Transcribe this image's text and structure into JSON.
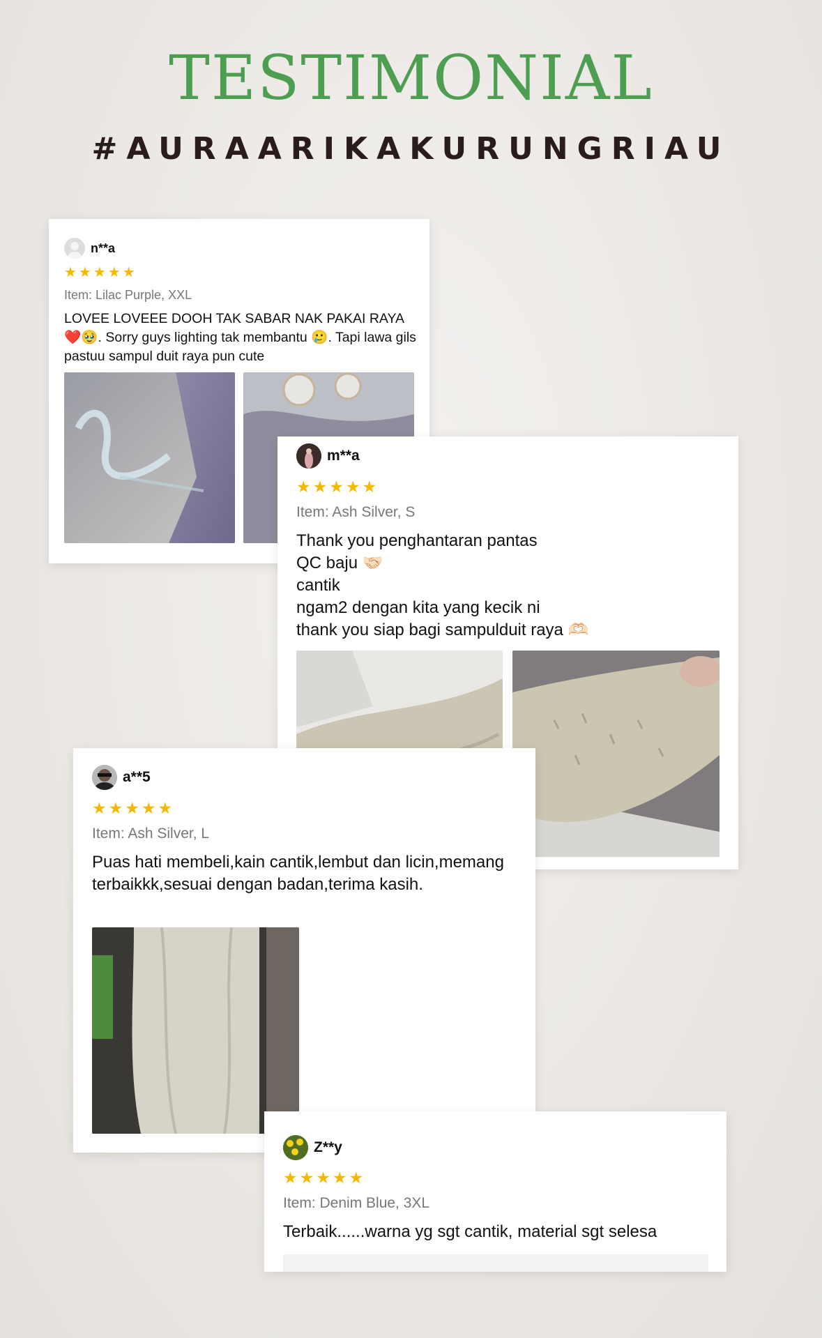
{
  "page": {
    "title": "TESTIMONIAL",
    "hashtag": "#AURAARIKAKURUNGRIAU"
  },
  "colors": {
    "title": "#4e9e52",
    "hashtag": "#2a1c1a",
    "stars": "#f5b800"
  },
  "reviews": [
    {
      "user": "n**a",
      "stars": "★★★★★",
      "rating": 5,
      "item": "Item: Lilac Purple, XXL",
      "text": "LOVEE LOVEEE DOOH TAK SABAR NAK PAKAI RAYA ❤️🥹. Sorry guys lighting tak membantu 🥲. Tapi lawa gils pastuu sampul duit raya pun cute",
      "avatar_icon": "default-user-icon"
    },
    {
      "user": "m**a",
      "stars": "★★★★★",
      "rating": 5,
      "item": "Item: Ash Silver, S",
      "text": "Thank you penghantaran pantas\nQC baju 🤝🏻\ncantik\nngam2 dengan kita yang kecik ni\nthank you siap bagi sampulduit raya 🫶🏻",
      "avatar_icon": "user-photo-icon"
    },
    {
      "user": "a**5",
      "stars": "★★★★★",
      "rating": 5,
      "item": "Item: Ash Silver, L",
      "text": "Puas hati membeli,kain cantik,lembut dan licin,memang terbaikkk,sesuai dengan badan,terima kasih.",
      "avatar_icon": "user-photo-icon"
    },
    {
      "user": "Z**y",
      "stars": "★★★★★",
      "rating": 5,
      "item": "Item: Denim Blue, 3XL",
      "text": "Terbaik......warna yg sgt cantik, material sgt selesa",
      "avatar_icon": "flower-photo-icon"
    }
  ]
}
